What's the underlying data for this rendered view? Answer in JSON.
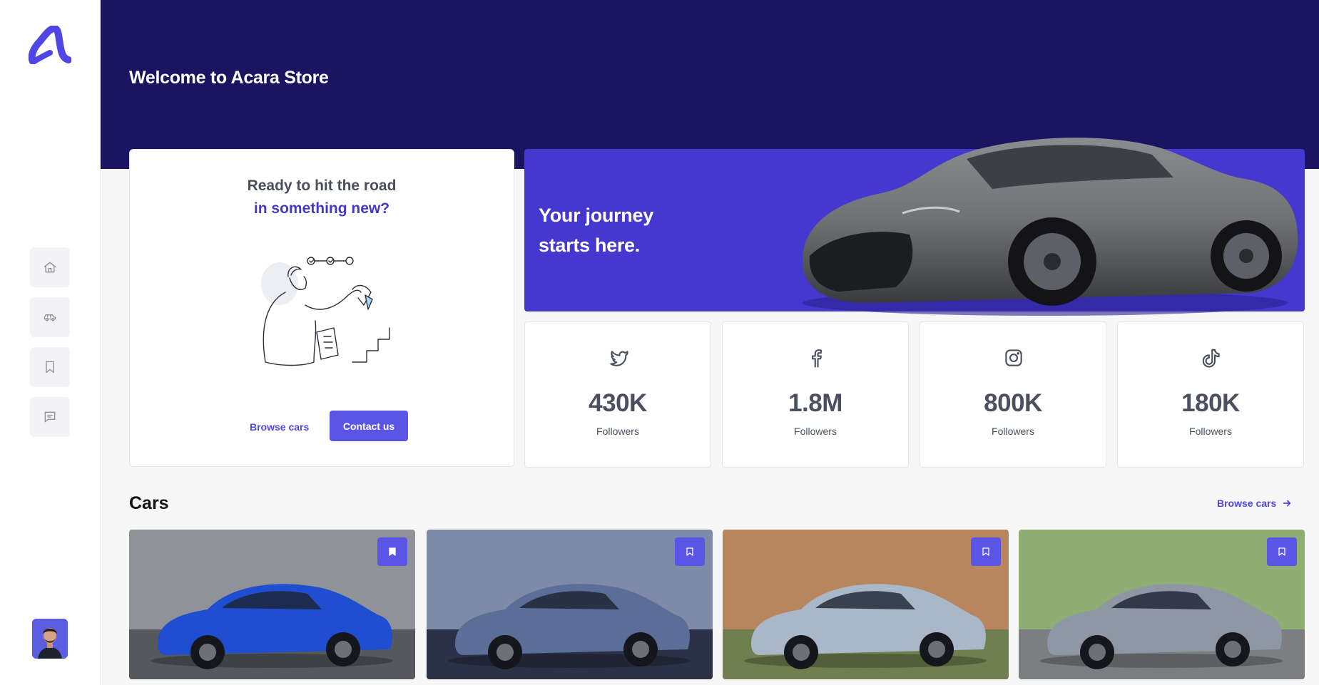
{
  "app": {
    "brand": "Acara Store"
  },
  "header": {
    "welcome": "Welcome to Acara Store"
  },
  "sidebar": {
    "items": [
      {
        "label": "Home",
        "icon": "home-icon"
      },
      {
        "label": "Cars",
        "icon": "car-icon"
      },
      {
        "label": "Saved",
        "icon": "bookmark-icon"
      },
      {
        "label": "Messages",
        "icon": "chat-icon"
      }
    ]
  },
  "promo": {
    "line1": "Ready to hit the road",
    "line2": "in something new?",
    "browse_label": "Browse cars",
    "contact_label": "Contact us"
  },
  "hero": {
    "line1": "Your journey",
    "line2": "starts here."
  },
  "social": [
    {
      "platform": "twitter",
      "icon": "twitter-icon",
      "count": "430K",
      "label": "Followers"
    },
    {
      "platform": "facebook",
      "icon": "facebook-icon",
      "count": "1.8M",
      "label": "Followers"
    },
    {
      "platform": "instagram",
      "icon": "instagram-icon",
      "count": "800K",
      "label": "Followers"
    },
    {
      "platform": "tiktok",
      "icon": "tiktok-icon",
      "count": "180K",
      "label": "Followers"
    }
  ],
  "cars": {
    "title": "Cars",
    "browse_label": "Browse cars",
    "items": [
      {
        "color": "#1f4fd0",
        "bookmarked": true
      },
      {
        "color": "#5b6e97",
        "bookmarked": false
      },
      {
        "color": "#a9b7c9",
        "bookmarked": false
      },
      {
        "color": "#8e97a3",
        "bookmarked": false
      }
    ]
  },
  "colors": {
    "primary": "#5b55e6",
    "header": "#1b1460",
    "hero": "#4438cf"
  }
}
